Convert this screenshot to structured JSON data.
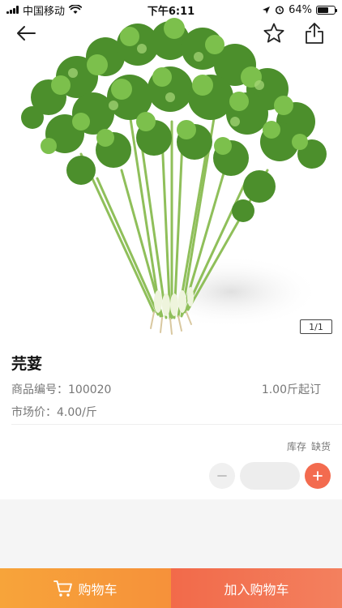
{
  "status_bar": {
    "carrier": "中国移动",
    "time": "下午6:11",
    "battery": "64%",
    "battery_level": 0.64
  },
  "icons": {
    "back": "arrow-left-icon",
    "favorite": "star-icon",
    "share": "share-icon",
    "cart": "cart-icon"
  },
  "gallery": {
    "indicator": "1/1"
  },
  "product": {
    "name": "芫荽",
    "code_label": "商品编号：",
    "code": "100020",
    "min_order": "1.00斤起订",
    "price_label": "市场价：",
    "price": "4.00/斤",
    "stock_label": "库存",
    "stock_status": "缺货"
  },
  "stepper": {
    "value": ""
  },
  "bottom": {
    "cart_label": "购物车",
    "add_cart_label": "加入购物车"
  },
  "colors": {
    "accent": "#f36b4f",
    "cart_orange": "#f7a43a"
  }
}
